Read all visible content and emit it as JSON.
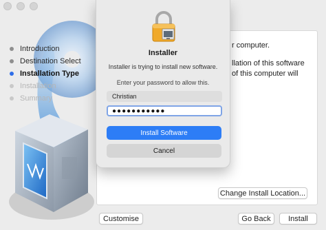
{
  "window": {
    "traffic_lights": [
      "close",
      "minimize",
      "zoom"
    ]
  },
  "sidebar": {
    "steps": [
      {
        "label": "Introduction",
        "state": "done"
      },
      {
        "label": "Destination Select",
        "state": "done"
      },
      {
        "label": "Installation Type",
        "state": "active"
      },
      {
        "label": "Installation",
        "state": "disabled"
      },
      {
        "label": "Summary",
        "state": "disabled"
      }
    ]
  },
  "content": {
    "lines": [
      "r computer.",
      "",
      "llation of this software",
      "of this computer will"
    ]
  },
  "buttons": {
    "change_location": "Change Install Location...",
    "customise": "Customise",
    "go_back": "Go Back",
    "install": "Install"
  },
  "dialog": {
    "title": "Installer",
    "message": "Installer is trying to install new software.",
    "prompt": "Enter your password to allow this.",
    "username": "Christian",
    "password_mask": "●●●●●●●●●●●",
    "install_button": "Install Software",
    "cancel_button": "Cancel",
    "accent": "#2d7df6"
  },
  "icons": {
    "dialog_icon": "lock-icon",
    "art": "virtualbox-box-art"
  }
}
